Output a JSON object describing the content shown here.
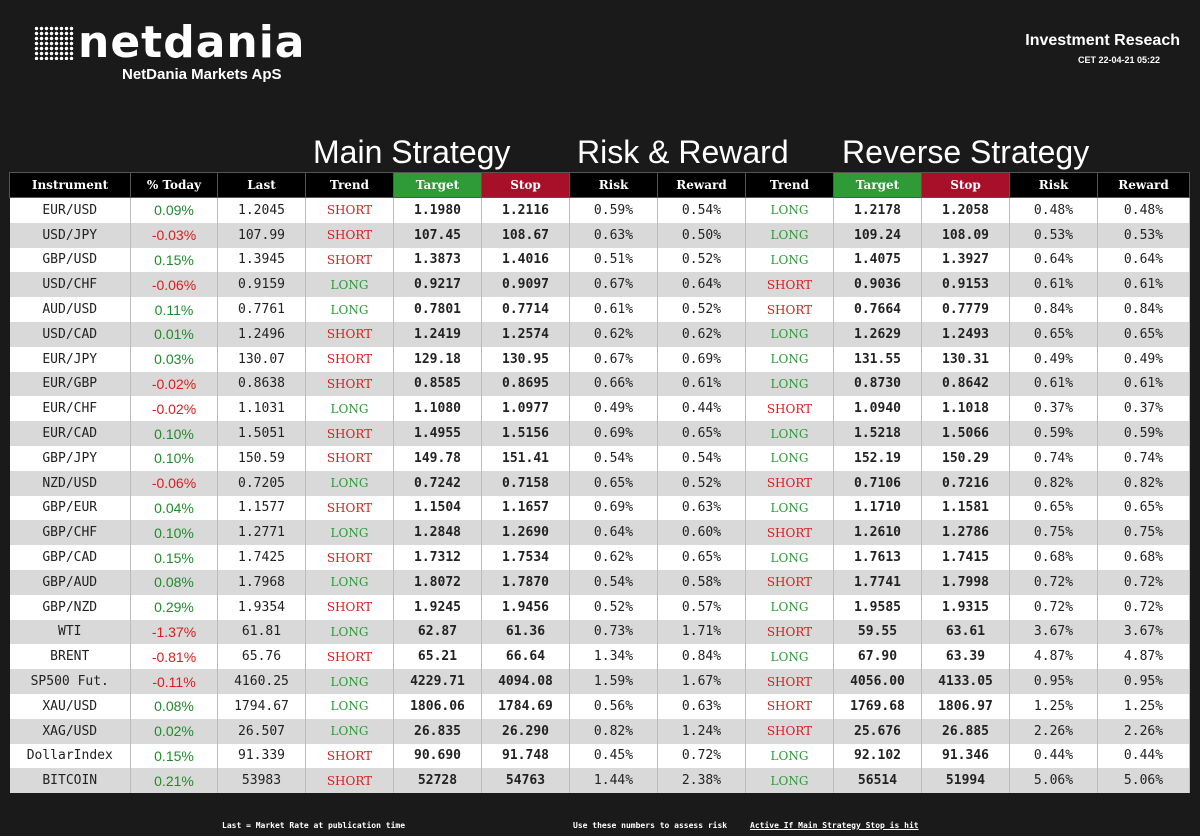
{
  "brand": {
    "wordmark": "netdania",
    "company": "NetDania Markets ApS"
  },
  "header": {
    "title": "Investment Reseach",
    "timestamp": "CET  22-04-21 05:22"
  },
  "sections": {
    "main": "Main Strategy",
    "risk": "Risk & Reward",
    "reverse": "Reverse Strategy"
  },
  "columns": [
    "Instrument",
    "% Today",
    "Last",
    "Trend",
    "Target",
    "Stop",
    "Risk",
    "Reward",
    "Trend",
    "Target",
    "Stop",
    "Risk",
    "Reward"
  ],
  "rows": [
    [
      "EUR/USD",
      "0.09%",
      "1.2045",
      "SHORT",
      "1.1980",
      "1.2116",
      "0.59%",
      "0.54%",
      "LONG",
      "1.2178",
      "1.2058",
      "0.48%",
      "0.48%"
    ],
    [
      "USD/JPY",
      "-0.03%",
      "107.99",
      "SHORT",
      "107.45",
      "108.67",
      "0.63%",
      "0.50%",
      "LONG",
      "109.24",
      "108.09",
      "0.53%",
      "0.53%"
    ],
    [
      "GBP/USD",
      "0.15%",
      "1.3945",
      "SHORT",
      "1.3873",
      "1.4016",
      "0.51%",
      "0.52%",
      "LONG",
      "1.4075",
      "1.3927",
      "0.64%",
      "0.64%"
    ],
    [
      "USD/CHF",
      "-0.06%",
      "0.9159",
      "LONG",
      "0.9217",
      "0.9097",
      "0.67%",
      "0.64%",
      "SHORT",
      "0.9036",
      "0.9153",
      "0.61%",
      "0.61%"
    ],
    [
      "AUD/USD",
      "0.11%",
      "0.7761",
      "LONG",
      "0.7801",
      "0.7714",
      "0.61%",
      "0.52%",
      "SHORT",
      "0.7664",
      "0.7779",
      "0.84%",
      "0.84%"
    ],
    [
      "USD/CAD",
      "0.01%",
      "1.2496",
      "SHORT",
      "1.2419",
      "1.2574",
      "0.62%",
      "0.62%",
      "LONG",
      "1.2629",
      "1.2493",
      "0.65%",
      "0.65%"
    ],
    [
      "EUR/JPY",
      "0.03%",
      "130.07",
      "SHORT",
      "129.18",
      "130.95",
      "0.67%",
      "0.69%",
      "LONG",
      "131.55",
      "130.31",
      "0.49%",
      "0.49%"
    ],
    [
      "EUR/GBP",
      "-0.02%",
      "0.8638",
      "SHORT",
      "0.8585",
      "0.8695",
      "0.66%",
      "0.61%",
      "LONG",
      "0.8730",
      "0.8642",
      "0.61%",
      "0.61%"
    ],
    [
      "EUR/CHF",
      "-0.02%",
      "1.1031",
      "LONG",
      "1.1080",
      "1.0977",
      "0.49%",
      "0.44%",
      "SHORT",
      "1.0940",
      "1.1018",
      "0.37%",
      "0.37%"
    ],
    [
      "EUR/CAD",
      "0.10%",
      "1.5051",
      "SHORT",
      "1.4955",
      "1.5156",
      "0.69%",
      "0.65%",
      "LONG",
      "1.5218",
      "1.5066",
      "0.59%",
      "0.59%"
    ],
    [
      "GBP/JPY",
      "0.10%",
      "150.59",
      "SHORT",
      "149.78",
      "151.41",
      "0.54%",
      "0.54%",
      "LONG",
      "152.19",
      "150.29",
      "0.74%",
      "0.74%"
    ],
    [
      "NZD/USD",
      "-0.06%",
      "0.7205",
      "LONG",
      "0.7242",
      "0.7158",
      "0.65%",
      "0.52%",
      "SHORT",
      "0.7106",
      "0.7216",
      "0.82%",
      "0.82%"
    ],
    [
      "GBP/EUR",
      "0.04%",
      "1.1577",
      "SHORT",
      "1.1504",
      "1.1657",
      "0.69%",
      "0.63%",
      "LONG",
      "1.1710",
      "1.1581",
      "0.65%",
      "0.65%"
    ],
    [
      "GBP/CHF",
      "0.10%",
      "1.2771",
      "LONG",
      "1.2848",
      "1.2690",
      "0.64%",
      "0.60%",
      "SHORT",
      "1.2610",
      "1.2786",
      "0.75%",
      "0.75%"
    ],
    [
      "GBP/CAD",
      "0.15%",
      "1.7425",
      "SHORT",
      "1.7312",
      "1.7534",
      "0.62%",
      "0.65%",
      "LONG",
      "1.7613",
      "1.7415",
      "0.68%",
      "0.68%"
    ],
    [
      "GBP/AUD",
      "0.08%",
      "1.7968",
      "LONG",
      "1.8072",
      "1.7870",
      "0.54%",
      "0.58%",
      "SHORT",
      "1.7741",
      "1.7998",
      "0.72%",
      "0.72%"
    ],
    [
      "GBP/NZD",
      "0.29%",
      "1.9354",
      "SHORT",
      "1.9245",
      "1.9456",
      "0.52%",
      "0.57%",
      "LONG",
      "1.9585",
      "1.9315",
      "0.72%",
      "0.72%"
    ],
    [
      "WTI",
      "-1.37%",
      "61.81",
      "LONG",
      "62.87",
      "61.36",
      "0.73%",
      "1.71%",
      "SHORT",
      "59.55",
      "63.61",
      "3.67%",
      "3.67%"
    ],
    [
      "BRENT",
      "-0.81%",
      "65.76",
      "SHORT",
      "65.21",
      "66.64",
      "1.34%",
      "0.84%",
      "LONG",
      "67.90",
      "63.39",
      "4.87%",
      "4.87%"
    ],
    [
      "SP500 Fut.",
      "-0.11%",
      "4160.25",
      "LONG",
      "4229.71",
      "4094.08",
      "1.59%",
      "1.67%",
      "SHORT",
      "4056.00",
      "4133.05",
      "0.95%",
      "0.95%"
    ],
    [
      "XAU/USD",
      "0.08%",
      "1794.67",
      "LONG",
      "1806.06",
      "1784.69",
      "0.56%",
      "0.63%",
      "SHORT",
      "1769.68",
      "1806.97",
      "1.25%",
      "1.25%"
    ],
    [
      "XAG/USD",
      "0.02%",
      "26.507",
      "LONG",
      "26.835",
      "26.290",
      "0.82%",
      "1.24%",
      "SHORT",
      "25.676",
      "26.885",
      "2.26%",
      "2.26%"
    ],
    [
      "DollarIndex",
      "0.15%",
      "91.339",
      "SHORT",
      "90.690",
      "91.748",
      "0.45%",
      "0.72%",
      "LONG",
      "92.102",
      "91.346",
      "0.44%",
      "0.44%"
    ],
    [
      "BITCOIN",
      "0.21%",
      "53983",
      "SHORT",
      "52728",
      "54763",
      "1.44%",
      "2.38%",
      "LONG",
      "56514",
      "51994",
      "5.06%",
      "5.06%"
    ]
  ],
  "footer": {
    "last_note": "Last = Market Rate at publication time",
    "risk_note": "Use these numbers to assess risk",
    "active_note": "Active If Main Strategy Stop is hit"
  },
  "colors": {
    "target_header": "#2e9b36",
    "stop_header": "#a8102a",
    "positive": "#1e8c2a",
    "negative": "#e01b1b",
    "long": "#2a9a36",
    "short": "#e01b1b"
  }
}
